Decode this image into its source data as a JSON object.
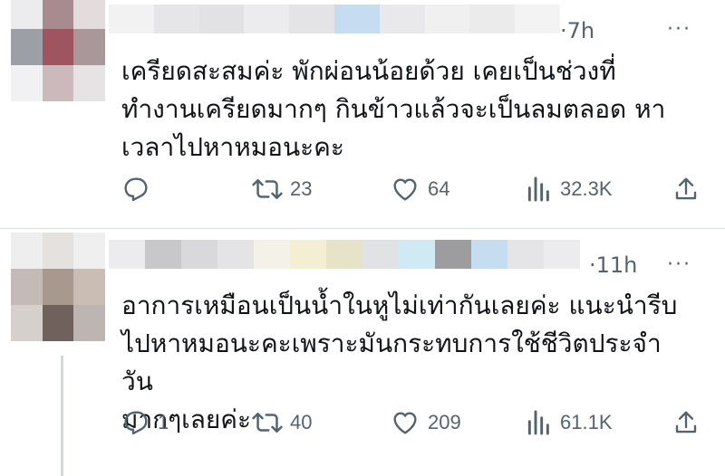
{
  "tweets": [
    {
      "time": "·7h",
      "more": "···",
      "text": "เครียดสะสมค่ะ พักผ่อนน้อยด้วย เคยเป็นช่วงที่\nทำงานเครียดมากๆ กินข้าวแล้วจะเป็นลมตลอด หา\nเวลาไปหาหมอนะคะ",
      "replies": "",
      "retweets": "23",
      "likes": "64",
      "views": "32.3K"
    },
    {
      "time": "·11h",
      "more": "···",
      "text": "อาการเหมือนเป็นน้ำในหูไม่เท่ากันเลยค่ะ แนะนำรีบ\nไปหาหมอนะคะเพราะมันกระทบการใช้ชีวิตประจำวัน\nมากๆเลยค่ะ",
      "replies": "1",
      "retweets": "40",
      "likes": "209",
      "views": "61.1K"
    }
  ],
  "icons": {
    "reply": "reply-icon",
    "retweet": "retweet-icon",
    "like": "heart-icon",
    "views": "views-icon",
    "share": "share-icon"
  },
  "colors": {
    "text": "#0f1419",
    "muted": "#536471",
    "divider": "#dbe1e6",
    "thread_line": "#cfd9de"
  }
}
